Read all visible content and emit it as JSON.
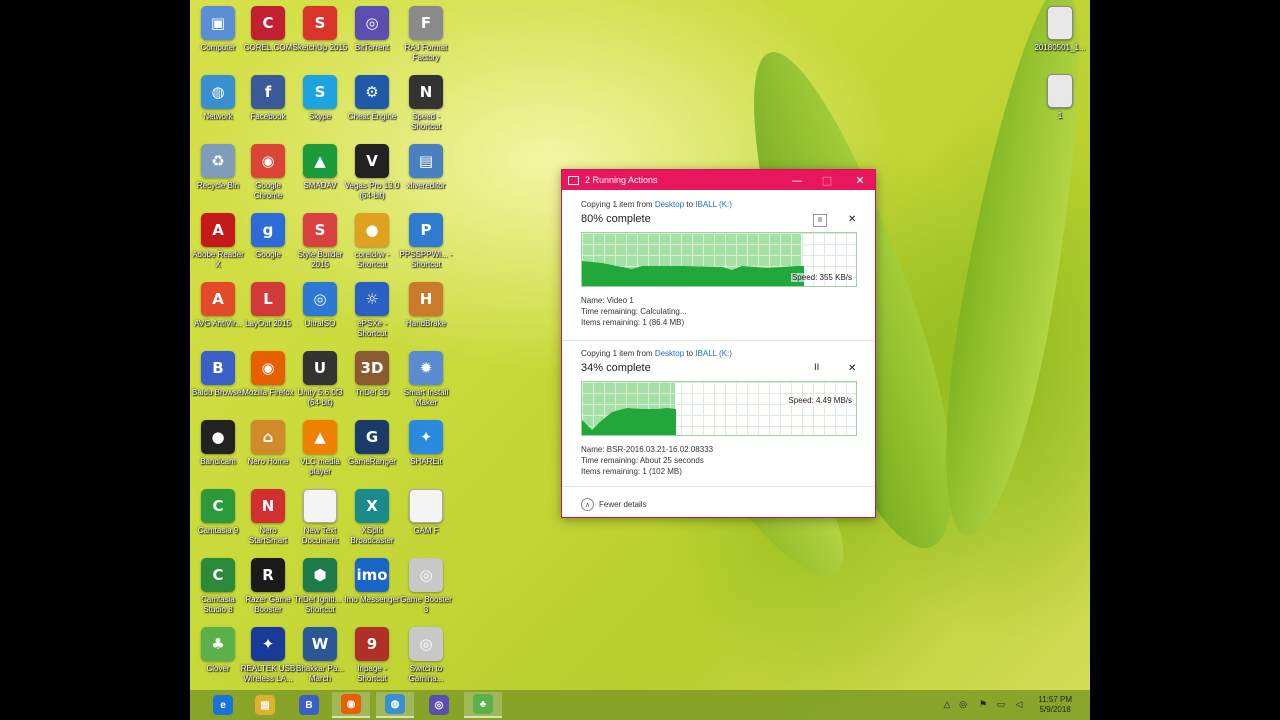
{
  "desktop_icons": [
    {
      "label": "Computer",
      "icon": "computer-icon",
      "color": "#5a8fd8",
      "glyph": "▣"
    },
    {
      "label": "COREL.COM",
      "icon": "corel-icon",
      "color": "#c02030",
      "glyph": "C"
    },
    {
      "label": "SketchUp 2015",
      "icon": "sketchup-icon",
      "color": "#d8342a",
      "glyph": "S"
    },
    {
      "label": "BitTorrent",
      "icon": "bittorrent-icon",
      "color": "#5a4fb0",
      "glyph": "◎"
    },
    {
      "label": "RAJ Format Factory",
      "icon": "format-factory-icon",
      "color": "#8a8a8a",
      "glyph": "F"
    },
    {
      "label": "Network",
      "icon": "network-icon",
      "color": "#3a8fd0",
      "glyph": "◍"
    },
    {
      "label": "Facebook",
      "icon": "facebook-icon",
      "color": "#3b5998",
      "glyph": "f"
    },
    {
      "label": "Skype",
      "icon": "skype-icon",
      "color": "#1aa4e0",
      "glyph": "S"
    },
    {
      "label": "Cheat Engine",
      "icon": "cheat-engine-icon",
      "color": "#1e5aa8",
      "glyph": "⚙"
    },
    {
      "label": "Speed - Shortcut",
      "icon": "need-for-speed-icon",
      "color": "#333333",
      "glyph": "N"
    },
    {
      "label": "Recycle Bin",
      "icon": "recycle-bin-icon",
      "color": "#7f9db9",
      "glyph": "♻"
    },
    {
      "label": "Google Chrome",
      "icon": "chrome-icon",
      "color": "#db4437",
      "glyph": "◉"
    },
    {
      "label": "SMADAV",
      "icon": "smadav-icon",
      "color": "#1c9b3b",
      "glyph": "▲"
    },
    {
      "label": "Vegas Pro 13.0 (64-bit)",
      "icon": "vegas-icon",
      "color": "#222222",
      "glyph": "V"
    },
    {
      "label": "xlivereditor",
      "icon": "installer-icon",
      "color": "#4a7fc0",
      "glyph": "▤"
    },
    {
      "label": "Adobe Reader X",
      "icon": "adobe-reader-icon",
      "color": "#c61a1a",
      "glyph": "A"
    },
    {
      "label": "Google",
      "icon": "google-icon",
      "color": "#2d6bd6",
      "glyph": "g"
    },
    {
      "label": "Style Builder 2015",
      "icon": "style-builder-icon",
      "color": "#d94040",
      "glyph": "S"
    },
    {
      "label": "coreldrw - Shortcut",
      "icon": "coreldraw-icon",
      "color": "#e0a020",
      "glyph": "●"
    },
    {
      "label": "PPSSPPWi... - Shortcut",
      "icon": "ppsspp-icon",
      "color": "#2e7bd0",
      "glyph": "P"
    },
    {
      "label": "AVG AntiVir...",
      "icon": "avg-icon",
      "color": "#e24a2a",
      "glyph": "A"
    },
    {
      "label": "LayOut 2015",
      "icon": "layout-icon",
      "color": "#d23a3a",
      "glyph": "L"
    },
    {
      "label": "UltraISO",
      "icon": "ultraiso-icon",
      "color": "#2c78d4",
      "glyph": "◎"
    },
    {
      "label": "ePSXe - Shortcut",
      "icon": "epsxe-icon",
      "color": "#2a5fc4",
      "glyph": "☼"
    },
    {
      "label": "HandBrake",
      "icon": "handbrake-icon",
      "color": "#c97a2a",
      "glyph": "H"
    },
    {
      "label": "Baidu Browser",
      "icon": "baidu-browser-icon",
      "color": "#3a60c8",
      "glyph": "B"
    },
    {
      "label": "Mozilla Firefox",
      "icon": "firefox-icon",
      "color": "#e66000",
      "glyph": "◉"
    },
    {
      "label": "Unity 5.6.0f3 (64-bit)",
      "icon": "unity-icon",
      "color": "#333333",
      "glyph": "U"
    },
    {
      "label": "TriDef 3D",
      "icon": "tridef-icon",
      "color": "#8a5a30",
      "glyph": "3D"
    },
    {
      "label": "Smart Install Maker",
      "icon": "smart-install-icon",
      "color": "#5a8ad0",
      "glyph": "✹"
    },
    {
      "label": "Bandicam",
      "icon": "bandicam-icon",
      "color": "#222222",
      "glyph": "●"
    },
    {
      "label": "Nero Home",
      "icon": "nero-home-icon",
      "color": "#d08a2a",
      "glyph": "⌂"
    },
    {
      "label": "VLC media player",
      "icon": "vlc-icon",
      "color": "#f08000",
      "glyph": "▲"
    },
    {
      "label": "GameRanger",
      "icon": "gameranger-icon",
      "color": "#1a3a6a",
      "glyph": "G"
    },
    {
      "label": "SHAREit",
      "icon": "shareit-icon",
      "color": "#2a8ae0",
      "glyph": "✦"
    },
    {
      "label": "Camtasia 9",
      "icon": "camtasia-icon",
      "color": "#2a9a3a",
      "glyph": "C"
    },
    {
      "label": "Nero StartSmart",
      "icon": "nero-startsmart-icon",
      "color": "#d23030",
      "glyph": "N"
    },
    {
      "label": "New Text Document",
      "icon": "text-document-icon",
      "color": "#f4f4f4",
      "glyph": ""
    },
    {
      "label": "XSplit Broadcaster",
      "icon": "xsplit-icon",
      "color": "#1a8a8a",
      "glyph": "X"
    },
    {
      "label": "GAM F",
      "icon": "document-icon",
      "color": "#f4f4f4",
      "glyph": ""
    },
    {
      "label": "Camtasia Studio 8",
      "icon": "camtasia-studio-icon",
      "color": "#2a8a3a",
      "glyph": "C"
    },
    {
      "label": "Razer Game Booster",
      "icon": "razer-icon",
      "color": "#1a1a1a",
      "glyph": "R"
    },
    {
      "label": "TriDef Igniti... - Shortcut",
      "icon": "tridef-ignition-icon",
      "color": "#1e7a4a",
      "glyph": "⬢"
    },
    {
      "label": "Imo Messenger",
      "icon": "imo-icon",
      "color": "#1a66c8",
      "glyph": "imo"
    },
    {
      "label": "Game Booster 3",
      "icon": "game-booster-icon",
      "color": "#c8c8c8",
      "glyph": "◎"
    },
    {
      "label": "Clover",
      "icon": "clover-icon",
      "color": "#5ab04a",
      "glyph": "♣"
    },
    {
      "label": "REALTEK USB Wireless LA...",
      "icon": "realtek-icon",
      "color": "#1a3a9a",
      "glyph": "✦"
    },
    {
      "label": "Bhakkar Pa... March",
      "icon": "word-document-icon",
      "color": "#2b5797",
      "glyph": "W"
    },
    {
      "label": "Inpage - Shortcut",
      "icon": "inpage-icon",
      "color": "#b0302a",
      "glyph": "9"
    },
    {
      "label": "Switch to Gamina...",
      "icon": "switch-gaming-icon",
      "color": "#c8c8c8",
      "glyph": "◎"
    }
  ],
  "right_icons": [
    {
      "label": "20180501_1...",
      "icon": "image-file-icon"
    },
    {
      "label": "1",
      "icon": "image-file-icon"
    }
  ],
  "dialog": {
    "title": "2 Running Actions",
    "ops": [
      {
        "copy_prefix": "Copying 1 item from",
        "from": "Desktop",
        "to_word": "to",
        "dest": "IBALL (K:)",
        "percent_label": "80% complete",
        "progress": 0.8,
        "speed": "Speed: 355 KB/s",
        "pause": "II",
        "close": "✕",
        "name": "Name:  Video 1",
        "time": "Time remaining:  Calculating...",
        "items": "Items remaining:  1 (86.4 MB)"
      },
      {
        "copy_prefix": "Copying 1 item from",
        "from": "Desktop",
        "to_word": "to",
        "dest": "IBALL (K:)",
        "percent_label": "34% complete",
        "progress": 0.34,
        "speed": "Speed: 4.49 MB/s",
        "pause": "II",
        "close": "✕",
        "name": "Name:  BSR-2016.03.21-16.02.08333",
        "time": "Time remaining:  About 25 seconds",
        "items": "Items remaining:  1 (102 MB)"
      }
    ],
    "fewer_details": "Fewer details",
    "chevron": "∧",
    "minimize": "—",
    "maximize": "□",
    "close": "✕"
  },
  "taskbar": {
    "apps": [
      {
        "icon": "internet-explorer-icon",
        "color": "#1a73d6",
        "glyph": "e"
      },
      {
        "icon": "file-explorer-icon",
        "color": "#e0b030",
        "glyph": "▤"
      },
      {
        "icon": "baidu-browser-icon",
        "color": "#3a60c8",
        "glyph": "B"
      },
      {
        "icon": "firefox-icon",
        "color": "#e66000",
        "glyph": "◉"
      },
      {
        "icon": "network-icon",
        "color": "#3a8fd0",
        "glyph": "◍"
      },
      {
        "icon": "bittorrent-icon",
        "color": "#5a4fb0",
        "glyph": "◎"
      },
      {
        "icon": "clover-icon",
        "color": "#5ab04a",
        "glyph": "♣"
      }
    ],
    "tray": [
      "△",
      "◎",
      "⚑",
      "▭",
      "◁"
    ],
    "time": "11:57 PM",
    "date": "5/9/2018"
  }
}
